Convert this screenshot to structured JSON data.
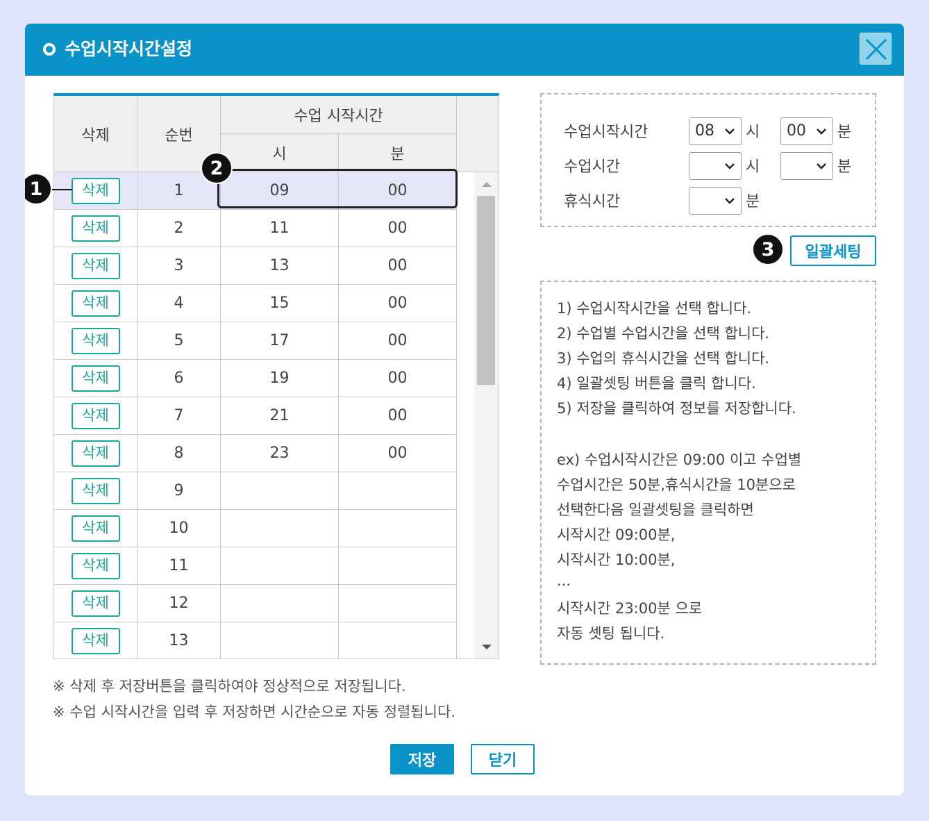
{
  "dialog": {
    "title": "수업시작시간설정"
  },
  "table": {
    "headers": {
      "delete": "삭제",
      "order": "순번",
      "start_time": "수업 시작시간",
      "hour": "시",
      "minute": "분"
    },
    "rows": [
      {
        "delete_label": "삭제",
        "order": "1",
        "hour": "09",
        "minute": "00"
      },
      {
        "delete_label": "삭제",
        "order": "2",
        "hour": "11",
        "minute": "00"
      },
      {
        "delete_label": "삭제",
        "order": "3",
        "hour": "13",
        "minute": "00"
      },
      {
        "delete_label": "삭제",
        "order": "4",
        "hour": "15",
        "minute": "00"
      },
      {
        "delete_label": "삭제",
        "order": "5",
        "hour": "17",
        "minute": "00"
      },
      {
        "delete_label": "삭제",
        "order": "6",
        "hour": "19",
        "minute": "00"
      },
      {
        "delete_label": "삭제",
        "order": "7",
        "hour": "21",
        "minute": "00"
      },
      {
        "delete_label": "삭제",
        "order": "8",
        "hour": "23",
        "minute": "00"
      },
      {
        "delete_label": "삭제",
        "order": "9",
        "hour": "",
        "minute": ""
      },
      {
        "delete_label": "삭제",
        "order": "10",
        "hour": "",
        "minute": ""
      },
      {
        "delete_label": "삭제",
        "order": "11",
        "hour": "",
        "minute": ""
      },
      {
        "delete_label": "삭제",
        "order": "12",
        "hour": "",
        "minute": ""
      },
      {
        "delete_label": "삭제",
        "order": "13",
        "hour": "",
        "minute": ""
      }
    ]
  },
  "markers": {
    "m1": "1",
    "m2": "2",
    "m3": "3"
  },
  "settings": {
    "start_label": "수업시작시간",
    "start_hour": "08",
    "start_minute": "00",
    "duration_label": "수업시간",
    "duration_hour": "",
    "duration_minute": "",
    "break_label": "휴식시간",
    "break_minute": "",
    "unit_hour": "시",
    "unit_minute": "분"
  },
  "bulk_button": "일괄세팅",
  "guide": [
    "1) 수업시작시간을 선택 합니다.",
    "2) 수업별 수업시간을 선택 합니다.",
    "3) 수업의 휴식시간을 선택 합니다.",
    "4) 일괄셋팅 버튼을 클릭 합니다.",
    "5) 저장을 클릭하여 정보를 저장합니다.",
    "ex) 수업시작시간은 09:00 이고 수업별",
    "수업시간은 50분,휴식시간을 10분으로",
    "선택한다음 일괄셋팅을 클릭하면",
    "시작시간 09:00분,",
    "시작시간 10:00분,",
    "...",
    "시작시간 23:00분 으로",
    "자동 셋팅 됩니다."
  ],
  "notes": [
    "※ 삭제 후 저장버튼을 클릭하여야 정상적으로 저장됩니다.",
    "※ 수업 시작시간을 입력 후 저장하면 시간순으로 자동 정렬됩니다."
  ],
  "footer": {
    "save": "저장",
    "close": "닫기"
  }
}
